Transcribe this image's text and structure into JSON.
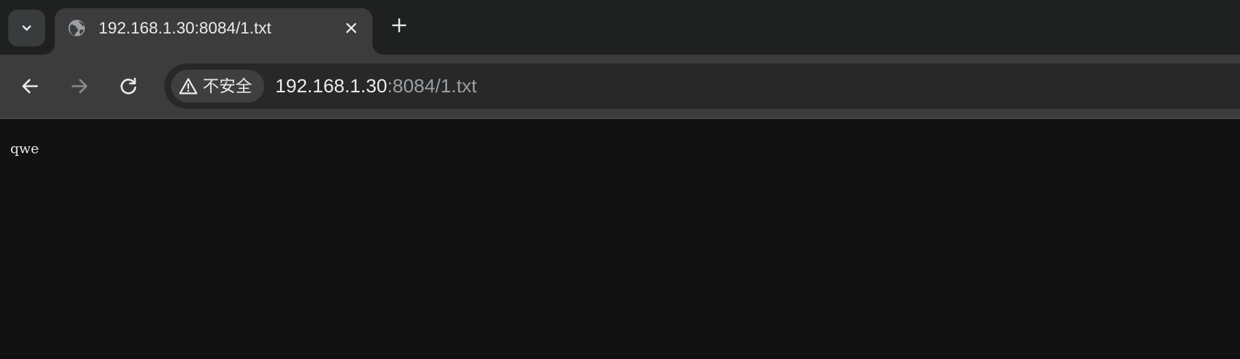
{
  "browser": {
    "theme": {
      "tabstrip_bg": "#1f2020",
      "active_tab_bg": "#3c3c3c",
      "omnibox_bg": "#282828",
      "page_bg": "#121212",
      "text_color": "#e8eaed",
      "muted_text_color": "#9aa0a6"
    },
    "tab_search": {
      "icon": "chevron-down-icon"
    },
    "tabs": [
      {
        "title": "192.168.1.30:8084/1.txt",
        "favicon": "globe-icon",
        "active": true
      }
    ],
    "new_tab": {
      "icon": "plus-icon"
    },
    "toolbar": {
      "back": {
        "icon": "arrow-left-icon",
        "enabled": true
      },
      "forward": {
        "icon": "arrow-right-icon",
        "enabled": false
      },
      "reload": {
        "icon": "reload-icon"
      }
    },
    "omnibox": {
      "security_icon": "warning-triangle-icon",
      "security_label": "不安全",
      "url_host": "192.168.1.30",
      "url_rest": ":8084/1.txt"
    }
  },
  "page": {
    "text": "qwe"
  }
}
